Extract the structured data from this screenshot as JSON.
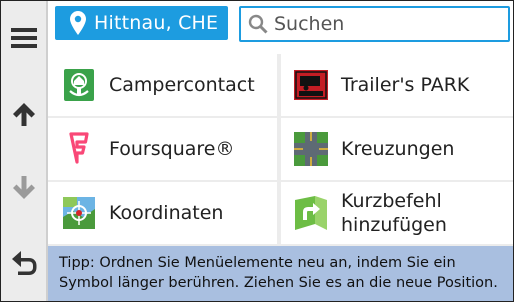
{
  "location": {
    "label": "Hittnau, CHE"
  },
  "search": {
    "placeholder": "Suchen"
  },
  "items": [
    {
      "label": "Campercontact"
    },
    {
      "label": "Trailer's PARK"
    },
    {
      "label": "Foursquare®"
    },
    {
      "label": "Kreuzungen"
    },
    {
      "label": "Koordinaten"
    },
    {
      "label_line1": "Kurzbefehl",
      "label_line2": "hinzufügen"
    }
  ],
  "tip": {
    "line1": "Tipp: Ordnen Sie Menüelemente neu an, indem Sie ein",
    "line2": "Symbol länger berühren. Ziehen Sie es an die neue Position."
  },
  "icons": {
    "menu": "hamburger-menu-icon",
    "up": "arrow-up-icon",
    "down": "arrow-down-icon",
    "back": "back-arrow-icon"
  },
  "colors": {
    "accent": "#1d9ce0",
    "tip_bg": "#a9bfe0",
    "rail_bg": "#ececec"
  }
}
